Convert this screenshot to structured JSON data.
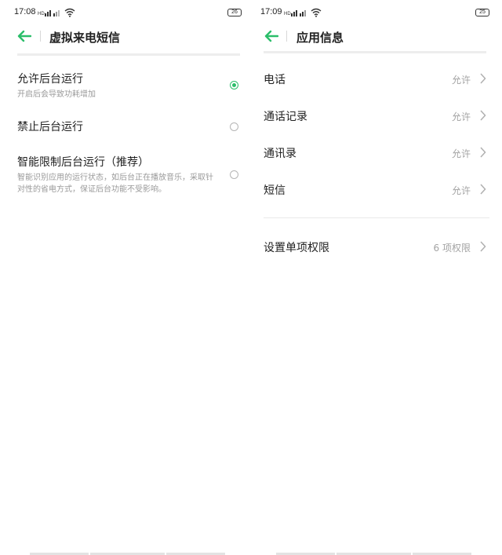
{
  "left": {
    "status": {
      "time": "17:08",
      "battery": "26"
    },
    "header": {
      "title": "虚拟来电短信"
    },
    "options": [
      {
        "title": "允许后台运行",
        "desc": "开启后会导致功耗增加",
        "checked": true
      },
      {
        "title": "禁止后台运行",
        "desc": "",
        "checked": false
      },
      {
        "title": "智能限制后台运行（推荐）",
        "desc": "智能识别应用的运行状态，如后台正在播放音乐，采取针对性的省电方式，保证后台功能不受影响。",
        "checked": false
      }
    ]
  },
  "right": {
    "status": {
      "time": "17:09",
      "battery": "25"
    },
    "header": {
      "title": "应用信息"
    },
    "permissions": [
      {
        "label": "电话",
        "value": "允许"
      },
      {
        "label": "通话记录",
        "value": "允许"
      },
      {
        "label": "通讯录",
        "value": "允许"
      },
      {
        "label": "短信",
        "value": "允许"
      }
    ],
    "single_permission": {
      "label": "设置单项权限",
      "value": "6 项权限"
    }
  },
  "colors": {
    "accent": "#2bbe6a",
    "text": "#222222",
    "secondary_text": "#9a9a9a",
    "divider": "#ededed"
  },
  "icons": {
    "back": "arrow-left-icon",
    "chevron": "chevron-right-icon",
    "signal": "signal-icon",
    "wifi": "wifi-icon",
    "battery": "battery-icon"
  }
}
